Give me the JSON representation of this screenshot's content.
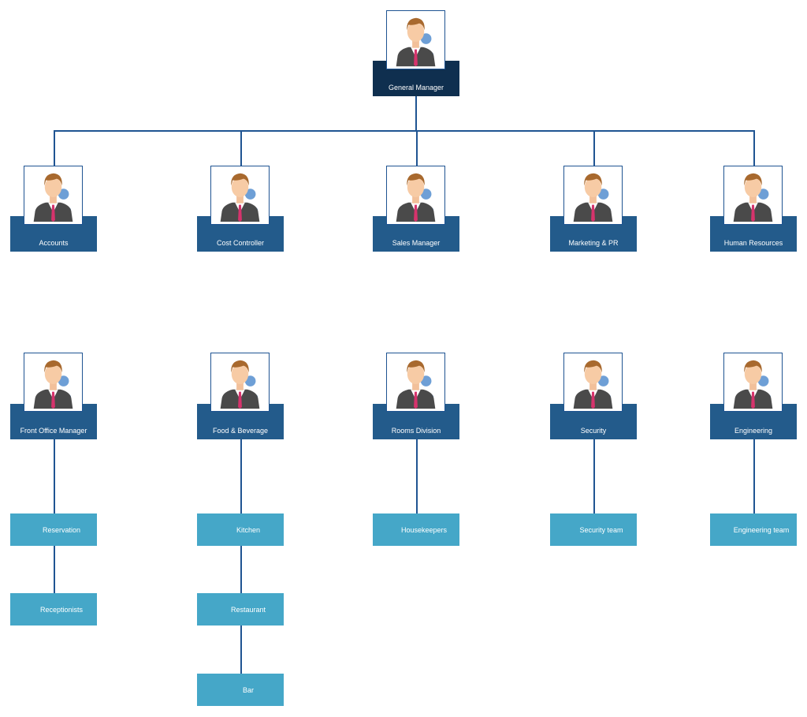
{
  "chart": {
    "root": {
      "label": "General Manager",
      "icon": "person-avatar-icon"
    },
    "departments": [
      {
        "label": "Accounts"
      },
      {
        "label": "Cost Controller"
      },
      {
        "label": "Sales Manager"
      },
      {
        "label": "Marketing & PR"
      },
      {
        "label": "Human Resources"
      }
    ],
    "divisions": [
      {
        "label": "Front Office Manager",
        "children": [
          "Reservation",
          "Receptionists"
        ]
      },
      {
        "label": "Food & Beverage",
        "children": [
          "Kitchen",
          "Restaurant",
          "Bar"
        ]
      },
      {
        "label": "Rooms Division",
        "children": [
          "Housekeepers"
        ]
      },
      {
        "label": "Security",
        "children": [
          "Security team"
        ]
      },
      {
        "label": "Engineering",
        "children": [
          "Engineering team"
        ]
      }
    ]
  },
  "colors": {
    "root": "#0f2f4f",
    "node": "#235b8b",
    "leaf": "#45a7c8",
    "connector": "#1f5492"
  }
}
